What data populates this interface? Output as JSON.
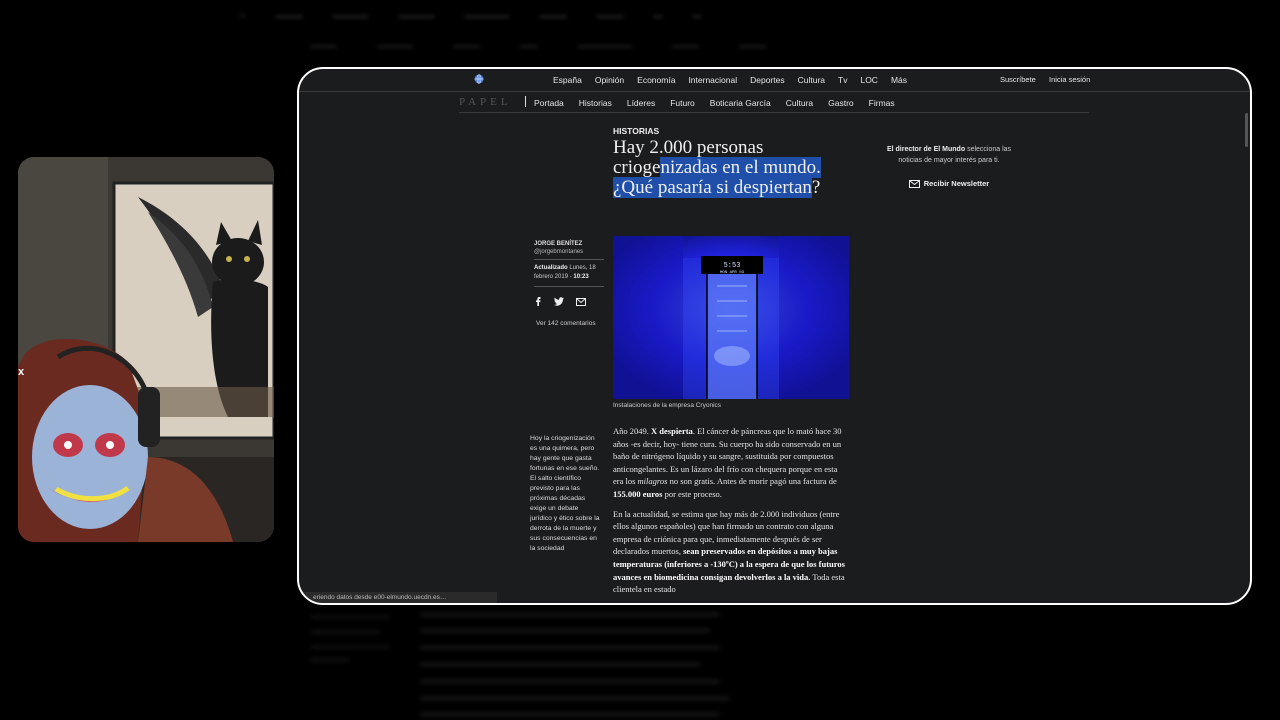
{
  "top_nav": [
    "España",
    "Opinión",
    "Economía",
    "Internacional",
    "Deportes",
    "Cultura",
    "Tv",
    "LOC",
    "Más"
  ],
  "account": {
    "subscribe": "Suscríbete",
    "login": "Inicia sesión"
  },
  "papel_logo": "PAPEL",
  "sub_nav": [
    "Portada",
    "Historias",
    "Líderes",
    "Futuro",
    "Boticaria García",
    "Cultura",
    "Gastro",
    "Firmas"
  ],
  "article": {
    "section": "HISTORIAS",
    "headline_part1": "Hay 2.000 personas crioge",
    "headline_hl1": "nizadas en el mundo.",
    "headline_hl2": "¿Qué pasaría si despiertan",
    "headline_end": "?",
    "image_text": "5:53",
    "image_subtext": "MON APR 03",
    "caption": "Instalaciones de la empresa Cryonics",
    "author_name": "JORGE BENÍTEZ",
    "author_handle": "@jorgebmontanes",
    "updated_label": "Actualizado",
    "updated_date": "Lunes, 18 febrero 2019 -",
    "updated_time": "10:23",
    "comments": "Ver 142 comentarios",
    "pull_quote": "Hoy la criogenización es una quimera, pero hay gente que gasta fortunas en ese sueño. El salto científico previsto para las próximas décadas exige un debate jurídico y ético sobre la derrota de la muerte y sus consecuencias en la sociedad",
    "p1_a": "Año 2049. ",
    "p1_b": "X despierta",
    "p1_c": ". El cáncer de páncreas que lo mató hace 30 años -es decir, hoy- tiene cura. Su cuerpo ha sido conservado en un baño de nitrógeno líquido y su sangre, sustituida por compuestos anticongelantes. Es un lázaro del frío con chequera porque en esta era los ",
    "p1_d": "milagros",
    "p1_e": " no son gratis. Antes de morir pagó una factura de ",
    "p1_f": "155.000 euros",
    "p1_g": " por este proceso.",
    "p2_a": "En la actualidad, se estima que hay más de 2.000 individuos (entre ellos algunos españoles) que han firmado un contrato con alguna empresa de criónica para que, inmediatamente después de ser declarados muertos, ",
    "p2_b": "sean preservados en depósitos a muy bajas temperaturas (inferiores a -130ºC) a la espera de que los futuros avances en biomedicina consigan devolverlos a la vida.",
    "p2_c": " Toda esta clientela en estado"
  },
  "sidebar": {
    "director_bold": "El director de El Mundo",
    "director_rest": " selecciona las noticias de mayor interés para ti.",
    "newsletter": "Recibir Newsletter"
  },
  "status_bar": "eriendo datos desde e00-elmundo.uecdn.es…",
  "colors": {
    "highlight": "#1f4fa8",
    "page_bg": "#1b1c1e",
    "image_blue": "#1a1aff"
  }
}
